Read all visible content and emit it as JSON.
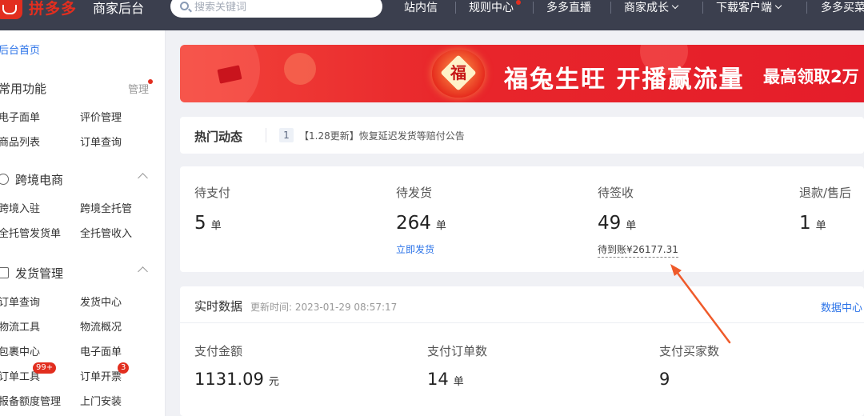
{
  "header": {
    "logo_text": "拼多多",
    "logo_sub": "商家后台",
    "search_placeholder": "搜索关键词",
    "nav": [
      {
        "label": "站内信"
      },
      {
        "label": "规则中心"
      },
      {
        "label": "多多直播"
      },
      {
        "label": "商家成长"
      },
      {
        "label": "下载客户端"
      },
      {
        "label": "多多买菜"
      }
    ]
  },
  "sidebar": {
    "home": "后台首页",
    "common_title": "常用功能",
    "manage": "管理",
    "common_items": [
      "电子面单",
      "评价管理",
      "商品列表",
      "订单查询"
    ],
    "cross_title": "跨境电商",
    "cross_items": [
      "跨境入驻",
      "跨境全托管",
      "全托管发货单",
      "全托管收入"
    ],
    "ship_title": "发货管理",
    "ship_items": [
      "订单查询",
      "发货中心",
      "物流工具",
      "物流概况",
      "包裹中心",
      "电子面单",
      "订单工具",
      "订单开票",
      "报备额度管理",
      "上门安装"
    ],
    "badge_order_tools": "99+",
    "badge_invoice": "3"
  },
  "banner": {
    "lantern_char": "福",
    "title": "福兔生旺  开播赢流量",
    "subtitle": "最高领取2万"
  },
  "hot": {
    "title": "热门动态",
    "num": "1",
    "text": "【1.28更新】恢复延迟发货等赔付公告"
  },
  "stats": [
    {
      "label": "待支付",
      "value": "5",
      "unit": "单"
    },
    {
      "label": "待发货",
      "value": "264",
      "unit": "单",
      "link": "立即发货"
    },
    {
      "label": "待签收",
      "value": "49",
      "unit": "单",
      "sub": "待到账¥26177.31"
    },
    {
      "label": "退款/售后",
      "value": "1",
      "unit": "单"
    }
  ],
  "realtime": {
    "title": "实时数据",
    "updated": "更新时间: 2023-01-29 08:57:17",
    "link": "数据中心",
    "metrics": [
      {
        "label": "支付金额",
        "value": "1131.09",
        "unit": "元"
      },
      {
        "label": "支付订单数",
        "value": "14",
        "unit": "单"
      },
      {
        "label": "支付买家数",
        "value": "9",
        "unit": ""
      }
    ]
  },
  "colors": {
    "brand_red": "#e22e1f",
    "topbar": "#3b3f4e",
    "link_blue": "#2b73e8",
    "annotation_arrow": "#ef5a2a"
  }
}
